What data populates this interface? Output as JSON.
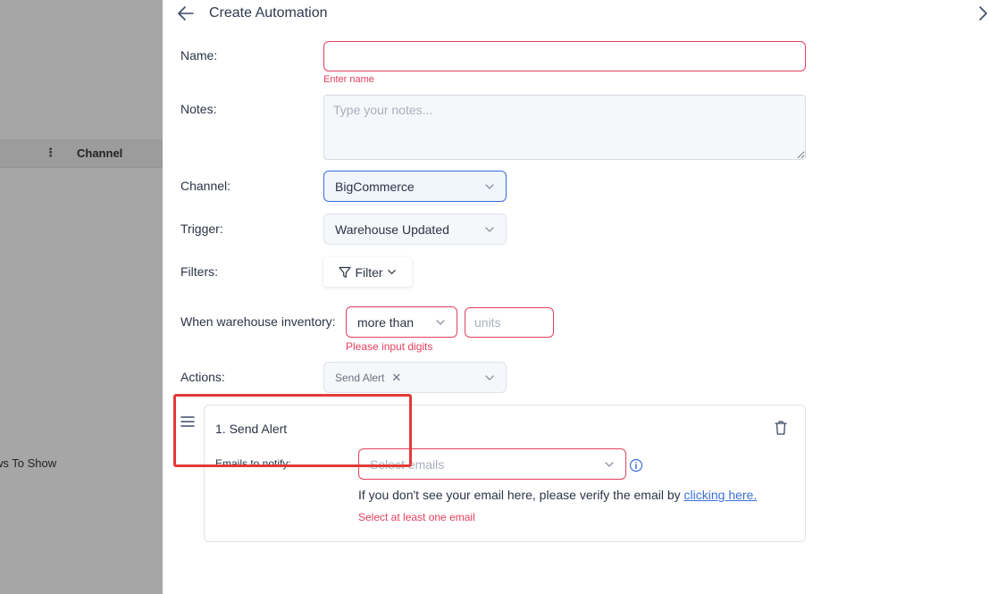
{
  "background": {
    "column_header": "Channel",
    "rows_text": "ws To Show"
  },
  "header": {
    "title": "Create Automation"
  },
  "form": {
    "name": {
      "label": "Name:",
      "value": "",
      "error": "Enter name"
    },
    "notes": {
      "label": "Notes:",
      "placeholder": "Type your notes..."
    },
    "channel": {
      "label": "Channel:",
      "value": "BigCommerce"
    },
    "trigger": {
      "label": "Trigger:",
      "value": "Warehouse Updated"
    },
    "filters": {
      "label": "Filters:",
      "button_label": "Filter"
    },
    "inventory": {
      "label": "When warehouse inventory:",
      "operator": "more than",
      "units_placeholder": "units",
      "error": "Please input digits"
    },
    "actions": {
      "label": "Actions:",
      "selected": [
        "Send Alert"
      ]
    }
  },
  "action_card": {
    "title": "1. Send Alert",
    "emails_label": "Emails to notify:",
    "emails_placeholder": "Select emails",
    "hint_text": "If you don't see your email here, please verify the email by ",
    "hint_link": "clicking here.",
    "error": "Select at least one email"
  },
  "colors": {
    "accent": "#3a6fd8",
    "error": "#e5405e",
    "highlight": "#e23a3a"
  }
}
